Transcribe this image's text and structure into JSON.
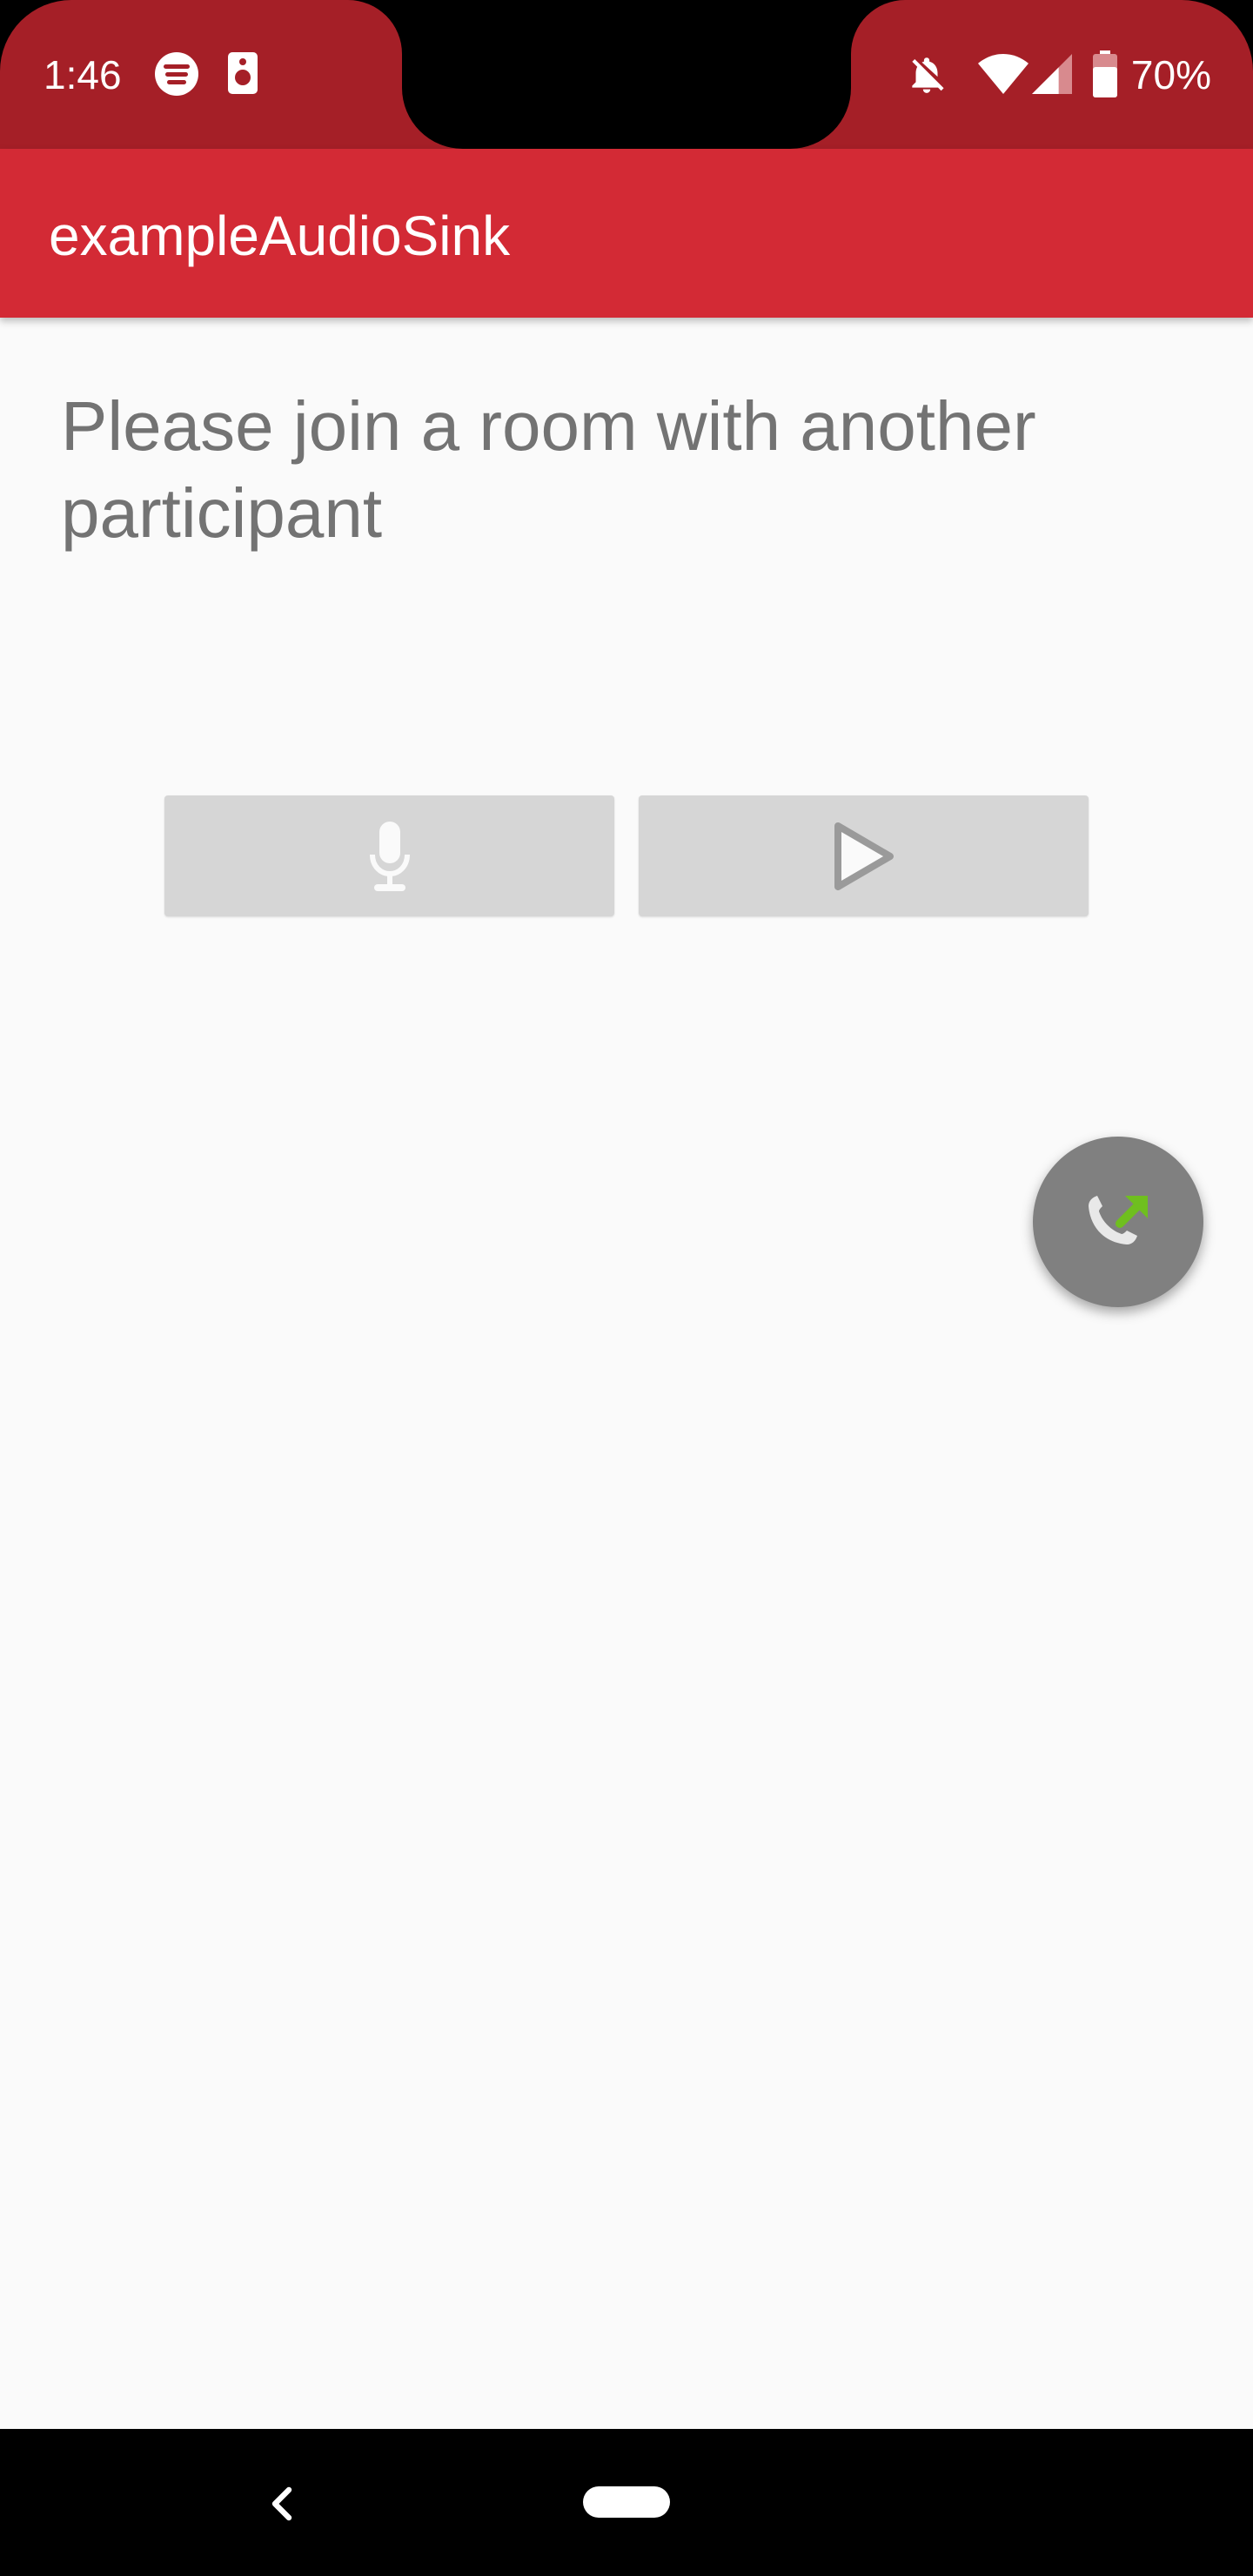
{
  "status_bar": {
    "time": "1:46",
    "battery_percent": "70%",
    "battery_level": 0.7,
    "icons": [
      "spotify-icon",
      "speaker-icon",
      "notifications-off-icon",
      "wifi-icon",
      "cell-signal-icon",
      "battery-icon"
    ]
  },
  "app_bar": {
    "title": "exampleAudioSink"
  },
  "content": {
    "message": "Please join a room with another participant",
    "buttons": [
      {
        "name": "microphone-button",
        "icon": "microphone-icon"
      },
      {
        "name": "play-button",
        "icon": "play-icon"
      }
    ],
    "fab": {
      "icon": "connect-call-icon"
    }
  },
  "colors": {
    "status_bar": "#a51f27",
    "app_bar": "#d32a35",
    "background": "#fafafa",
    "message_text": "#737373",
    "button_bg": "#d6d6d6",
    "fab_bg": "#808080",
    "fab_arrow": "#6fbf1f"
  },
  "nav_bar": {
    "items": [
      "back-icon",
      "home-pill"
    ]
  }
}
